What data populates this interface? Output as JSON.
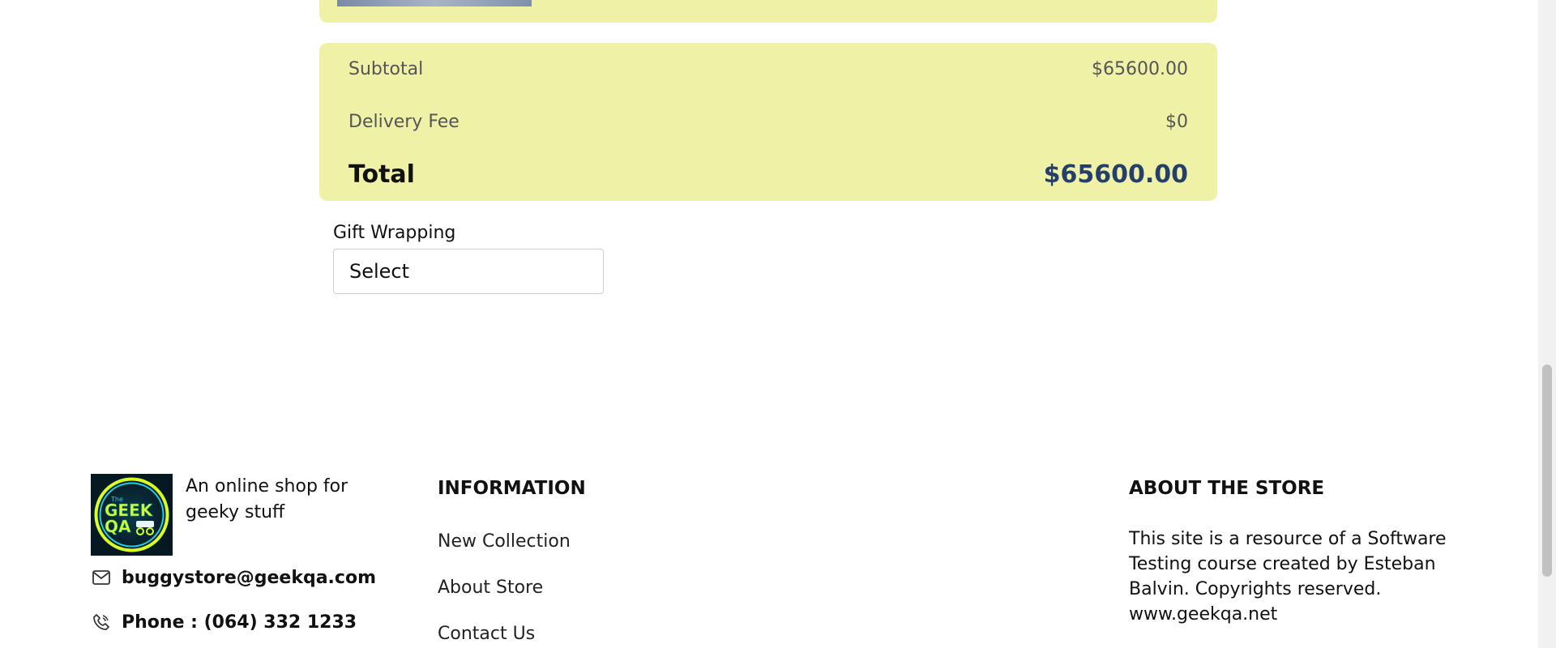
{
  "summary": {
    "subtotal_label": "Subtotal",
    "subtotal_value": "$65600.00",
    "delivery_label": "Delivery Fee",
    "delivery_value": "$0",
    "total_label": "Total",
    "total_value": "$65600.00"
  },
  "gift": {
    "label": "Gift Wrapping",
    "select_value": "Select"
  },
  "footer": {
    "logo": {
      "top_text": "The",
      "line1": "GEEK",
      "line2": "QA"
    },
    "tagline": "An online shop for geeky stuff",
    "email": "buggystore@geekqa.com",
    "phone": "Phone : (064) 332 1233",
    "information": {
      "heading": "INFORMATION",
      "links": [
        "New Collection",
        "About Store",
        "Contact Us"
      ]
    },
    "about": {
      "heading": "ABOUT THE STORE",
      "text": "This site is a resource of a Software Testing course created by Esteban Balvin. Copyrights reserved. www.geekqa.net"
    }
  },
  "colors": {
    "card_bg": "#eff2a6",
    "total_accent": "#24406a"
  },
  "icons": [
    "mail-icon",
    "phone-icon"
  ]
}
